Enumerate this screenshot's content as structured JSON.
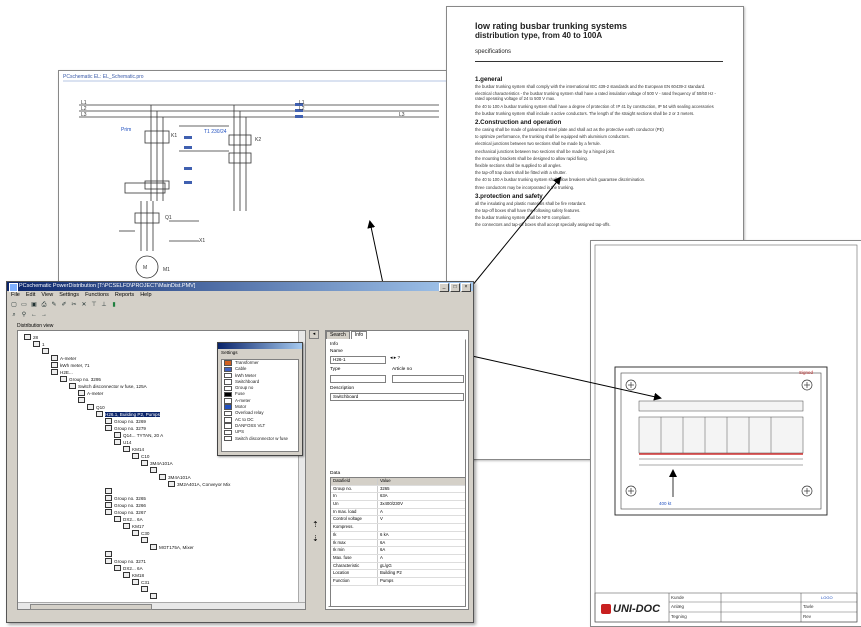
{
  "schematic": {
    "title": "PCschematic EL: EL_Schematic.pro",
    "labels": [
      "L1",
      "L2",
      "L3",
      "Prim",
      "T1 230/24",
      "K1",
      "K2",
      "Q1",
      "M1",
      "X1"
    ]
  },
  "spec": {
    "title_line1": "low rating busbar trunking systems",
    "title_line2": "distribution type, from 40 to 100A",
    "subtitle": "specifications",
    "sections": [
      {
        "heading": "1.general",
        "paragraphs": [
          "the busbar trunking system shall comply with the international IEC 439-2 standards and the European EN 60439-2 standard.",
          "electrical characteristics - the busbar trunking system shall have a rated insulation voltage of 500 V - rated frequency of 50/60 Hz - rated operating voltage of 24 to 500 V max.",
          "the 40 to 100 A busbar trunking system shall have a degree of protection of: IP 41 by construction, IP 54 with sealing accessories",
          "the busbar trunking system shall include 4 active conductors. The length of the straight sections shall be 2 or 3 meters."
        ]
      },
      {
        "heading": "2.Construction and operation",
        "paragraphs": [
          "the casing shall be made of galvanized steel plate and shall act as the protective earth conductor (PE)",
          "to optimize performance, the trunking shall be equipped with aluminium conductors.",
          "electrical junctions between two sections shall be made by a ferrule.",
          "mechanical junctions between two sections shall be made by a hinged joint.",
          "the mounting brackets shall be designed to allow rapid fixing.",
          "flexible sections shall be supplied to all angles.",
          "the tap-off trap doors shall be fitted with a shutter.",
          "the 40 to 100 A busbar trunking system shall allow breakers which guarantee discrimination.",
          "three conductors may be incorporated in the trunking."
        ]
      },
      {
        "heading": "3.protection and safety",
        "paragraphs": [
          "all the insulating and plastic materials shall be fire retardant.",
          "the tap-off boxes shall have the following safety features.",
          "the busbar trunking system shall be NFS compliant.",
          "the connectors and tap-off boxes shall accept specially assigned tap-offs."
        ]
      }
    ]
  },
  "drawing": {
    "label_top_right": "Signed",
    "label_bottom": "400 kt",
    "logo_text": "UNI-DOC",
    "titleblock_cells": [
      "Kunde",
      "Anlæg",
      "Tegning",
      "Tavle",
      "Rev",
      "Ark",
      "Dato",
      "Sign"
    ]
  },
  "app": {
    "title": "PCschematic PowerDistribution [T:\\PCSELFD\\PROJECT\\MainDist.PMV]",
    "menu": [
      "File",
      "Edit",
      "View",
      "Settings",
      "Functions",
      "Reports",
      "Help"
    ],
    "toolbar_icons": [
      "new-icon",
      "open-icon",
      "save-icon",
      "print-icon",
      "edit-icon",
      "pen-icon",
      "cut-icon",
      "delete-icon",
      "tree-icon",
      "tree2-icon",
      "chart-icon"
    ],
    "toolbar2_icons": [
      "zoom-icon",
      "find-icon",
      "back-icon",
      "forward-icon"
    ],
    "tree_header": "Distribution view",
    "tree": [
      {
        "text": "28",
        "depth": 0
      },
      {
        "text": "1",
        "depth": 1
      },
      {
        "text": "",
        "depth": 2
      },
      {
        "text": "A-meter",
        "depth": 3
      },
      {
        "text": "kWh meter, 71",
        "depth": 3
      },
      {
        "text": "H2E...",
        "depth": 3
      },
      {
        "text": "Group no. 3295",
        "depth": 4
      },
      {
        "text": "Switch disconnector w fuse, 125A",
        "depth": 5
      },
      {
        "text": "A-meter",
        "depth": 6
      },
      {
        "text": "",
        "depth": 6
      },
      {
        "text": "Q10",
        "depth": 7
      },
      {
        "text": "H26.1, Building P2, Pumps",
        "depth": 8,
        "selected": true
      },
      {
        "text": "Group no. 3269",
        "depth": 9
      },
      {
        "text": "Group no. 3279",
        "depth": 9
      },
      {
        "text": "Q14... TYTAN, 20 A",
        "depth": 10
      },
      {
        "text": "U14",
        "depth": 10
      },
      {
        "text": "KM14",
        "depth": 11
      },
      {
        "text": "C10",
        "depth": 12
      },
      {
        "text": "3M4A101A",
        "depth": 13
      },
      {
        "text": "",
        "depth": 14
      },
      {
        "text": "3M4A101A",
        "depth": 15
      },
      {
        "text": "3M2A401A, Conveyor Mix",
        "depth": 16
      },
      {
        "text": "",
        "depth": 9
      },
      {
        "text": "Group no. 3265",
        "depth": 9
      },
      {
        "text": "Group no. 3266",
        "depth": 9
      },
      {
        "text": "Group no. 3267",
        "depth": 9
      },
      {
        "text": "DX2... 6A",
        "depth": 10
      },
      {
        "text": "KM17",
        "depth": 11
      },
      {
        "text": "C30",
        "depth": 12
      },
      {
        "text": "",
        "depth": 13
      },
      {
        "text": "MGT175A, Mixer",
        "depth": 14
      },
      {
        "text": "",
        "depth": 9
      },
      {
        "text": "Group no. 3271",
        "depth": 9
      },
      {
        "text": "DX2... 6A",
        "depth": 10
      },
      {
        "text": "KM18",
        "depth": 11
      },
      {
        "text": "C31",
        "depth": 12
      },
      {
        "text": "",
        "depth": 13
      },
      {
        "text": "",
        "depth": 14
      }
    ],
    "legend": {
      "title": "Settings",
      "items": [
        {
          "label": "Transformer",
          "color": "#d06020"
        },
        {
          "label": "Cable",
          "color": "#4060c0"
        },
        {
          "label": "kWh Meter",
          "color": "#ffffff"
        },
        {
          "label": "Switchboard",
          "color": "#ffffff"
        },
        {
          "label": "Group no",
          "color": "#ffffff"
        },
        {
          "label": "Fuse",
          "color": "#000000"
        },
        {
          "label": "A-meter",
          "color": "#ffffff"
        },
        {
          "label": "Motor",
          "color": "#2050c0"
        },
        {
          "label": "Overload relay",
          "color": "#ffffff"
        },
        {
          "label": "AC to DC",
          "color": "#ffffff"
        },
        {
          "label": "DANFOSS VLT",
          "color": "#ffffff"
        },
        {
          "label": "UPS",
          "color": "#ffffff"
        },
        {
          "label": "Switch disconnector w fuse",
          "color": "#ffffff"
        }
      ]
    },
    "right": {
      "tabs": [
        "Search",
        "Info"
      ],
      "info_label": "Info",
      "name_label": "Name",
      "name_value": "H26-1",
      "type_label": "Type",
      "type_value": "",
      "article_label": "Article no",
      "article_value": "",
      "description_label": "Description",
      "description_value": "Switchboard",
      "data_label": "Data",
      "grid_header": [
        "Datafield",
        "Value"
      ],
      "grid_rows": [
        [
          "Group no.",
          "3265"
        ],
        [
          "In",
          "63A"
        ],
        [
          "Un",
          "3x400/230V"
        ],
        [
          "In max. load",
          "A"
        ],
        [
          "Control voltage",
          "V"
        ],
        [
          "Kompress.",
          ""
        ],
        [
          "Ik",
          "6 kA"
        ],
        [
          "Ik max",
          "6A"
        ],
        [
          "Ik min",
          "6A"
        ],
        [
          "Max. fuse",
          "A"
        ],
        [
          "Characteristic",
          "gL/gG"
        ],
        [
          "Location",
          "Building P2"
        ],
        [
          "Function",
          "Pumps"
        ]
      ]
    }
  }
}
